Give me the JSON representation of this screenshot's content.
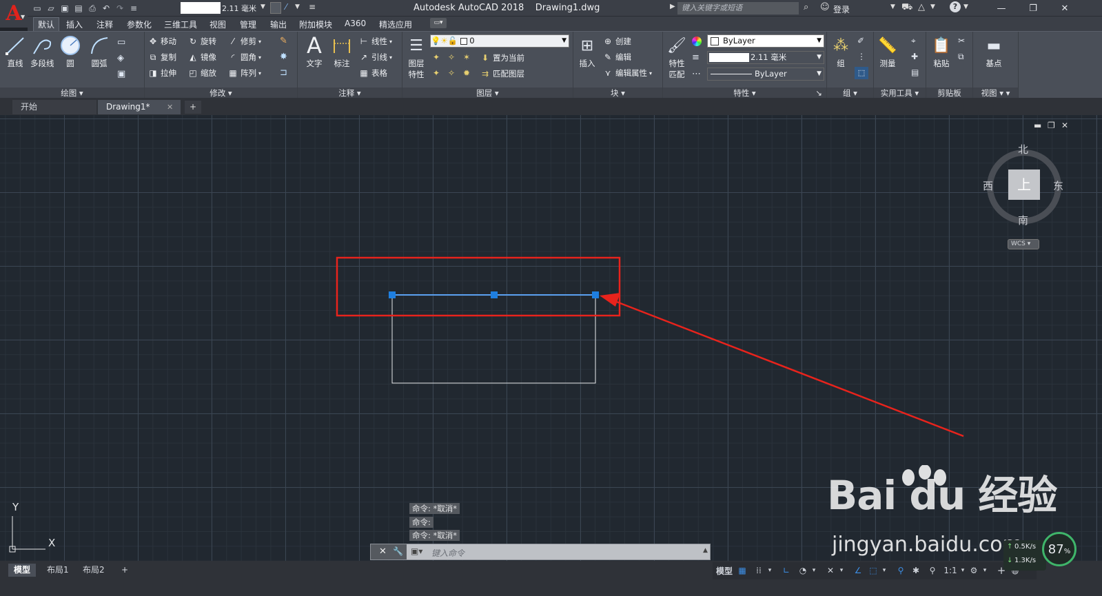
{
  "title_bar": {
    "app_title": "Autodesk AutoCAD 2018",
    "doc_name": "Drawing1.dwg",
    "scale_value": "2.11 毫米",
    "search_placeholder": "键入关键字或短语",
    "login_label": "登录"
  },
  "menu_tabs": [
    "默认",
    "插入",
    "注释",
    "参数化",
    "三维工具",
    "视图",
    "管理",
    "输出",
    "附加模块",
    "A360",
    "精选应用"
  ],
  "ribbon": {
    "draw": {
      "label": "绘图",
      "line": "直线",
      "polyline": "多段线",
      "circle": "圆",
      "arc": "圆弧"
    },
    "modify": {
      "label": "修改",
      "move": "移动",
      "rotate": "旋转",
      "trim": "修剪",
      "copy": "复制",
      "mirror": "镜像",
      "fillet": "圆角",
      "stretch": "拉伸",
      "scale": "缩放",
      "array": "阵列"
    },
    "annotation": {
      "label": "注释",
      "text": "文字",
      "dimension": "标注",
      "linear": "线性",
      "leader": "引线",
      "table": "表格"
    },
    "layers": {
      "label": "图层",
      "layer_props_1": "图层",
      "layer_props_2": "特性",
      "layer_value": "0",
      "make_current": "置为当前",
      "match_layer": "匹配图层"
    },
    "block": {
      "label": "块",
      "insert": "插入",
      "create": "创建",
      "edit": "编辑",
      "edit_attr": "编辑属性"
    },
    "properties": {
      "label": "特性",
      "match_1": "特性",
      "match_2": "匹配",
      "color": "ByLayer",
      "lineweight": "2.11 毫米",
      "linetype": "ByLayer"
    },
    "groups": {
      "label": "组",
      "group": "组"
    },
    "utilities": {
      "label": "实用工具",
      "measure": "测量"
    },
    "clipboard": {
      "label": "剪贴板",
      "paste": "粘贴"
    },
    "view": {
      "label": "视图",
      "base": "基点"
    }
  },
  "file_tabs": {
    "start": "开始",
    "drawing": "Drawing1*"
  },
  "viewcube": {
    "north": "北",
    "south": "南",
    "west": "西",
    "east": "东",
    "top": "上",
    "wcs": "WCS"
  },
  "ucs": {
    "y_label": "Y",
    "x_label": "X"
  },
  "command_history": [
    "命令: *取消*",
    "命令:",
    "命令: *取消*"
  ],
  "command_placeholder": "键入命令",
  "watermark": {
    "brand": "Bai du 经验",
    "url": "jingyan.baidu.com"
  },
  "layout_tabs": [
    "模型",
    "布局1",
    "布局2"
  ],
  "status_bar": {
    "model_label": "模型",
    "scale": "1:1"
  },
  "net_widget": {
    "up": "0.5K/s",
    "down": "1.3K/s",
    "percent": "87",
    "percent_sign": "%"
  },
  "colors": {
    "accent_red": "#e0231c",
    "grip_blue": "#1e7fe0",
    "selected_line": "#5aa0f0",
    "annotation_red": "#e8231c"
  }
}
